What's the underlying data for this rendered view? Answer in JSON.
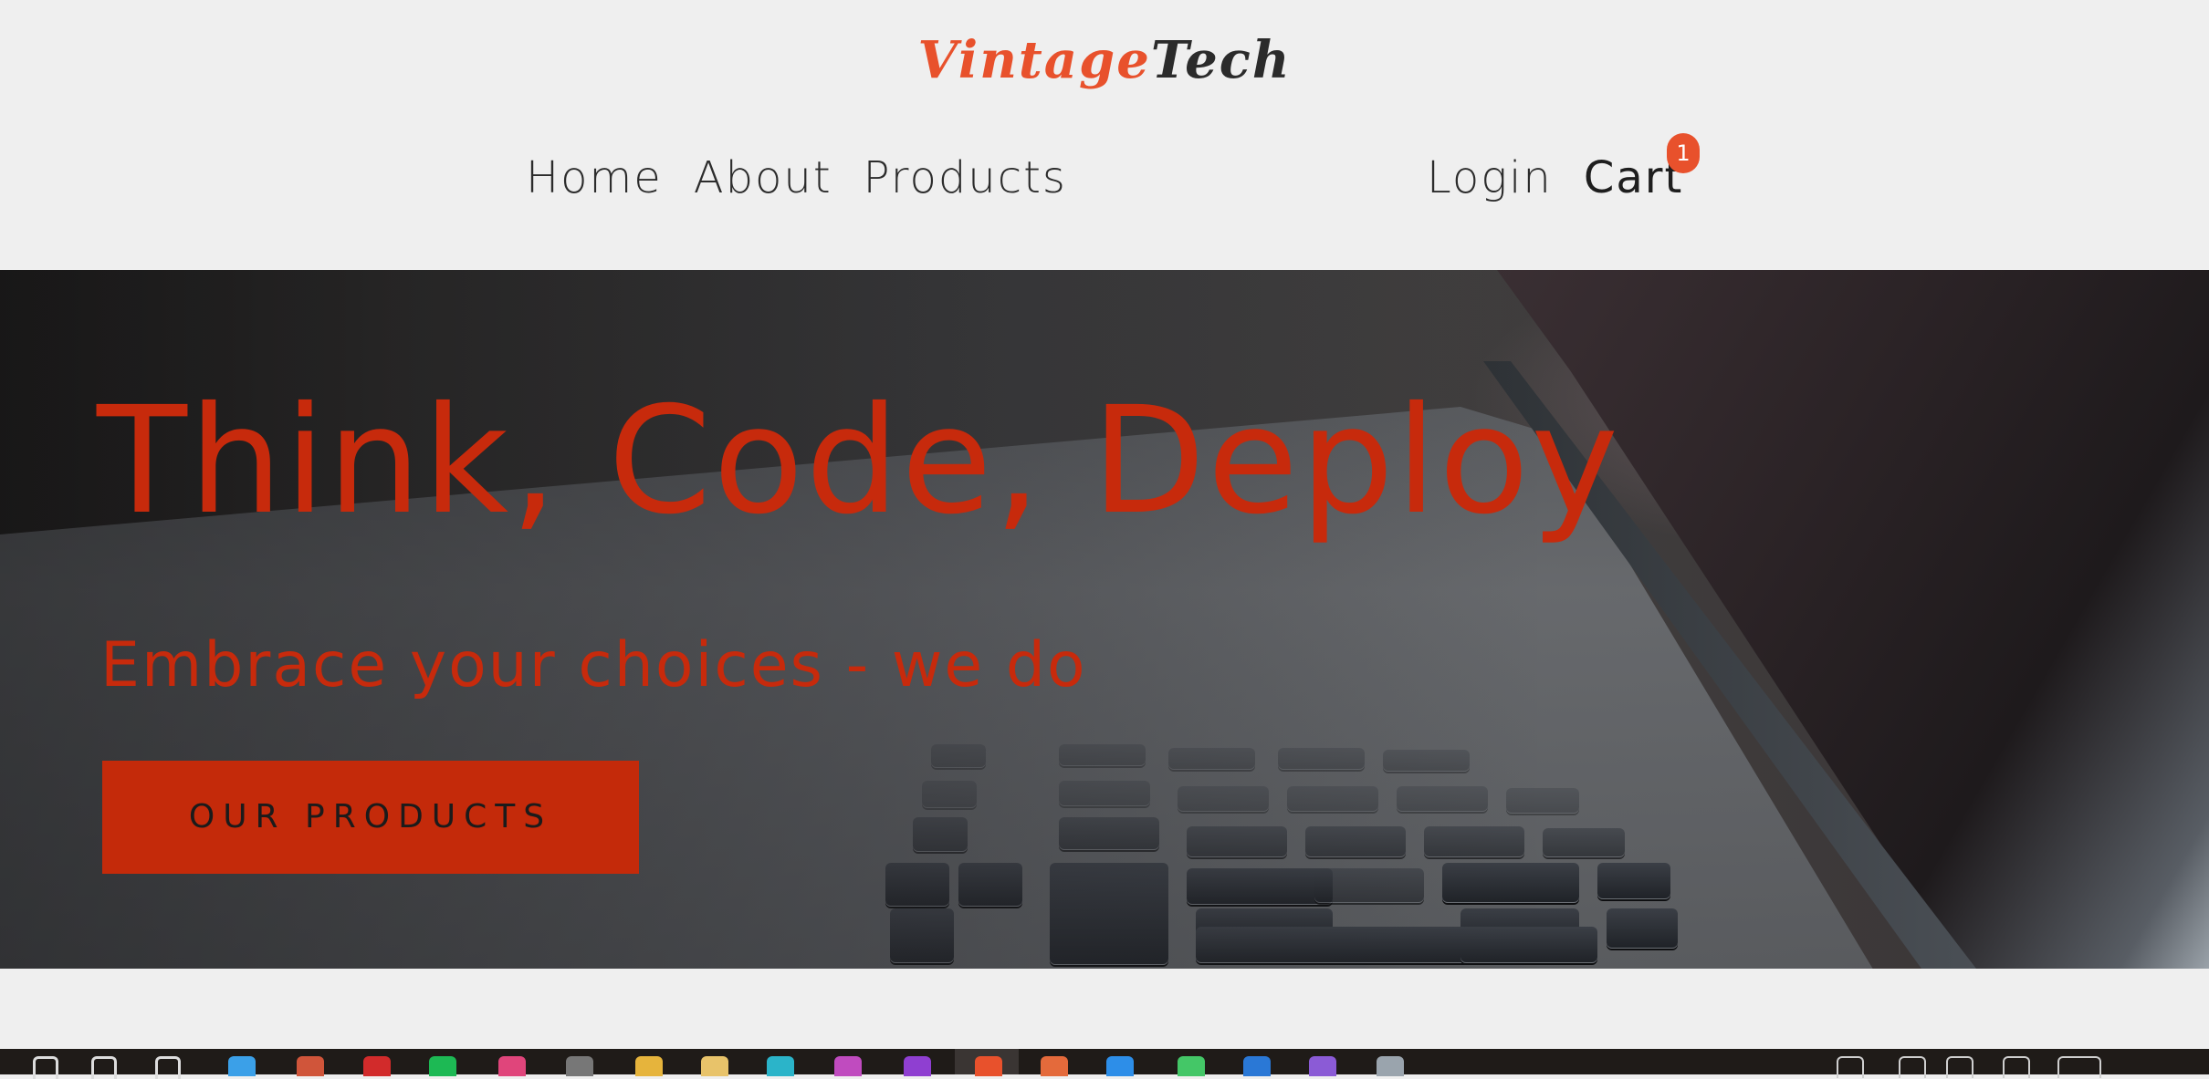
{
  "brand": {
    "part1": "Vintage",
    "part2": "Tech"
  },
  "nav": {
    "left": [
      {
        "label": "Home"
      },
      {
        "label": "About"
      },
      {
        "label": "Products"
      }
    ],
    "login_label": "Login",
    "cart_label": "Cart",
    "cart_count": "1"
  },
  "hero": {
    "title": "Think, Code, Deploy",
    "subtitle": "Embrace your choices - we do",
    "cta_label": "OUR PRODUCTS"
  },
  "colors": {
    "accent": "#e8512c",
    "hero_text": "#c72a0c",
    "cta_bg": "#c42a0a",
    "page_bg": "#efefef",
    "taskbar_bg": "#1f1b18"
  },
  "taskbar": {
    "icons": [
      "start-icon",
      "search-icon",
      "task-view-icon",
      "store-icon",
      "chrome-icon",
      "app-red-icon",
      "spotify-icon",
      "app-pink-icon",
      "app-gray-icon",
      "folder-icon",
      "pencil-icon",
      "edge-icon",
      "app-purple-icon",
      "podcast-icon",
      "chrome-active-icon",
      "app-orange-icon",
      "vscode-icon",
      "whatsapp-icon",
      "app-blue-icon",
      "app-violet-icon",
      "app-gray2-icon"
    ],
    "tray_icons": [
      "chevron-up-icon",
      "network-icon",
      "volume-icon",
      "battery-icon",
      "keyboard-icon"
    ]
  }
}
